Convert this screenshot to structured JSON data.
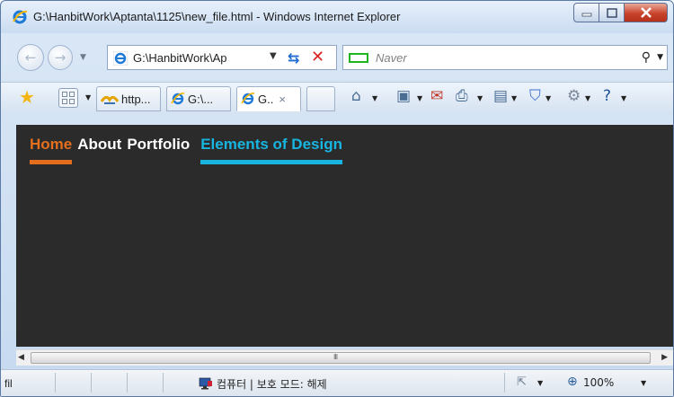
{
  "window": {
    "title": "G:\\HanbitWork\\Aptanta\\1125\\new_file.html - Windows Internet Explorer"
  },
  "addressbar": {
    "url": "G:\\HanbitWork\\Ap",
    "search_placeholder": "Naver"
  },
  "tabs": [
    {
      "label": "http...",
      "icon": "site-icon"
    },
    {
      "label": "G:\\...",
      "icon": "ie-icon"
    },
    {
      "label": "G..",
      "icon": "ie-icon",
      "active": true,
      "close": "×"
    },
    {
      "label": ""
    }
  ],
  "page": {
    "nav": [
      {
        "label": "Home",
        "color": "#e36f1e",
        "active": true
      },
      {
        "label": "About",
        "color": "#ffffff"
      },
      {
        "label": "Portfolio",
        "color": "#ffffff"
      },
      {
        "label": "Elements of Design",
        "color": "#18b5e0",
        "underline": true
      }
    ],
    "background": "#2b2b2b"
  },
  "scrollbar": {
    "grip": "III"
  },
  "statusbar": {
    "left_text": "fil",
    "zone_text": "컴퓨터 | 보호 모드: 해제",
    "zoom": "100%"
  },
  "colors": {
    "accent_orange": "#e36f1e",
    "accent_cyan": "#18b5e0",
    "close_button": "#c8442b"
  }
}
